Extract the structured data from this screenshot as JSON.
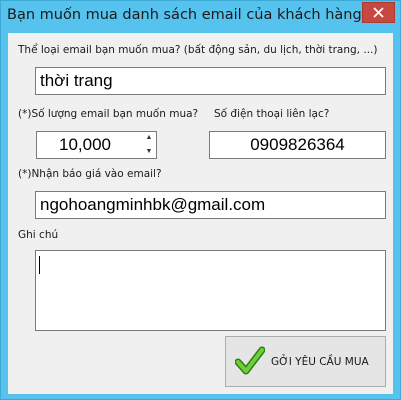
{
  "window": {
    "title": "Bạn muốn mua danh sách email của khách hàng?"
  },
  "form": {
    "category_label": "Thể loại email bạn muốn mua? (bất động sản, du lịch, thời trang, ...)",
    "category_value": "thời trang",
    "quantity_label": "(*)Số lượng email bạn muốn mua?",
    "quantity_value": "10,000",
    "phone_label": "Số điện thoại liên lạc?",
    "phone_value": "0909826364",
    "email_label": "(*)Nhận báo giá vào email?",
    "email_value": "ngohoangminhbk@gmail.com",
    "note_label": "Ghi chú",
    "note_value": "",
    "submit_label": "GỞI YÊU CẦU MUA"
  },
  "icons": {
    "close": "close-icon",
    "check": "checkmark-icon",
    "stepper_up": "chevron-up-icon",
    "stepper_down": "chevron-down-icon"
  },
  "colors": {
    "titlebar": "#56c3ee",
    "close_button": "#c7483f",
    "client_background": "#f0f0f0",
    "check_green": "#4caf2a"
  }
}
